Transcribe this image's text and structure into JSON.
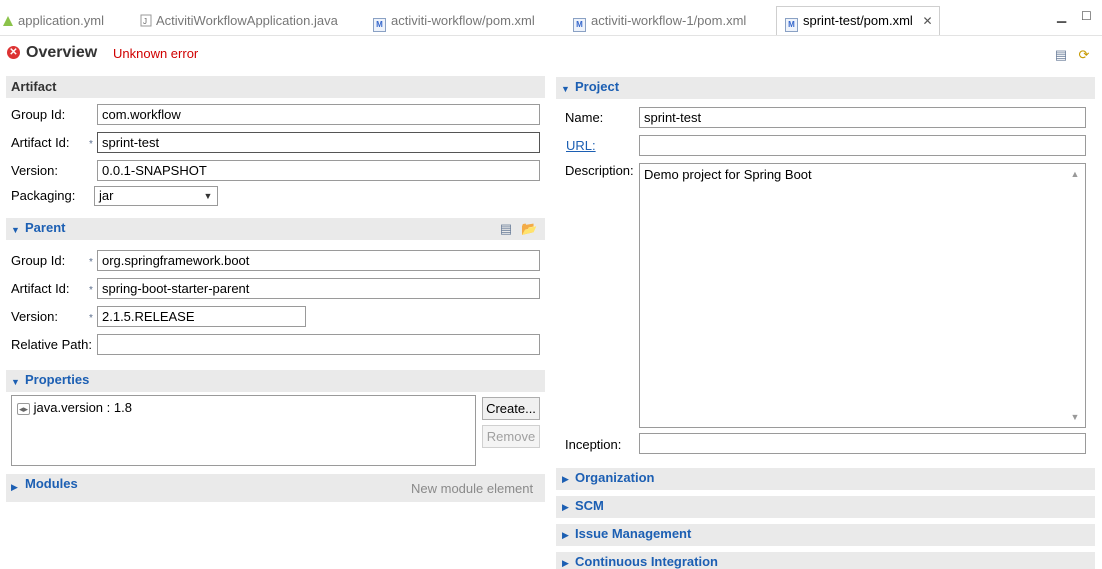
{
  "tabs": [
    {
      "label": "application.yml",
      "icon": "yml-file-icon"
    },
    {
      "label": "ActivitiWorkflowApplication.java",
      "icon": "java-file-icon"
    },
    {
      "label": "activiti-workflow/pom.xml",
      "icon": "maven-pom-icon"
    },
    {
      "label": "activiti-workflow-1/pom.xml",
      "icon": "maven-pom-icon"
    },
    {
      "label": "sprint-test/pom.xml",
      "icon": "maven-pom-icon",
      "active": true
    }
  ],
  "header": {
    "title": "Overview",
    "error": "Unknown error"
  },
  "artifact": {
    "title": "Artifact",
    "group_id_label": "Group Id:",
    "group_id": "com.workflow",
    "artifact_id_label": "Artifact Id:",
    "artifact_id": "sprint-test",
    "version_label": "Version:",
    "version": "0.0.1-SNAPSHOT",
    "packaging_label": "Packaging:",
    "packaging": "jar"
  },
  "parent": {
    "title": "Parent",
    "group_id_label": "Group Id:",
    "group_id": "org.springframework.boot",
    "artifact_id_label": "Artifact Id:",
    "artifact_id": "spring-boot-starter-parent",
    "version_label": "Version:",
    "version": "2.1.5.RELEASE",
    "relative_path_label": "Relative Path:",
    "relative_path": ""
  },
  "properties": {
    "title": "Properties",
    "items": [
      "java.version : 1.8"
    ],
    "create_label": "Create...",
    "remove_label": "Remove"
  },
  "modules": {
    "title": "Modules",
    "new_module_label": "New module element"
  },
  "project": {
    "title": "Project",
    "name_label": "Name:",
    "name": "sprint-test",
    "url_label": "URL:",
    "url": "",
    "description_label": "Description:",
    "description": "Demo project for Spring Boot",
    "inception_label": "Inception:",
    "inception": ""
  },
  "collapsed_sections": [
    "Organization",
    "SCM",
    "Issue Management",
    "Continuous Integration"
  ],
  "required_marker": "*",
  "colors": {
    "section_title": "#1c5fb3",
    "error": "#d00000",
    "section_bg": "#eaeaea"
  }
}
